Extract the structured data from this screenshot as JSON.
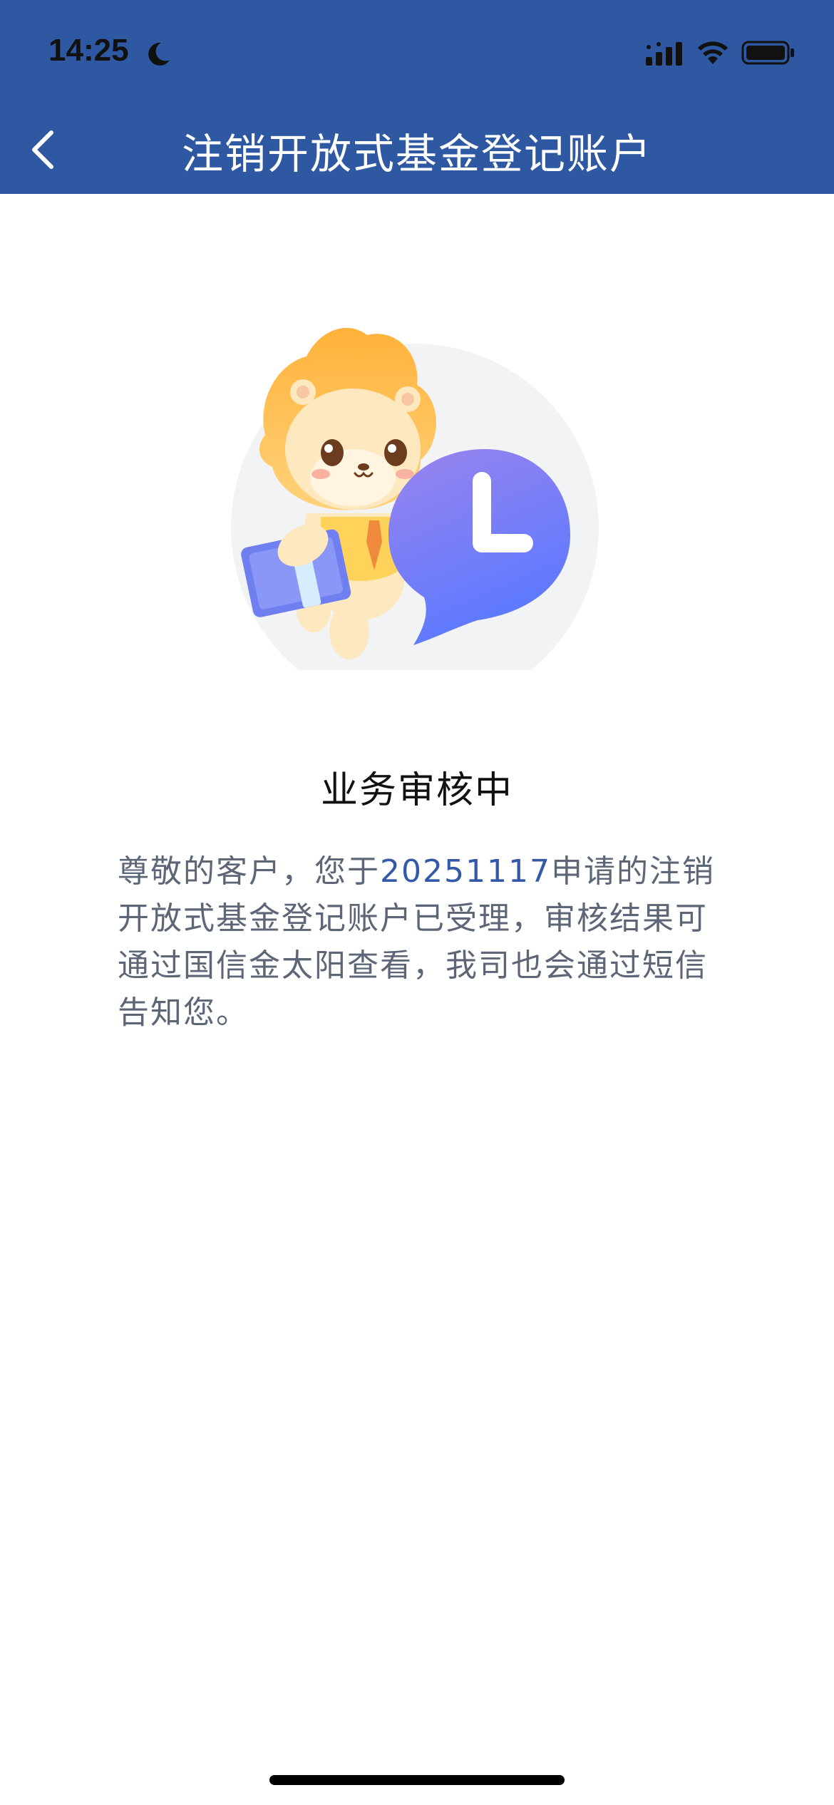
{
  "status_bar": {
    "time": "14:25",
    "moon_icon": "moon-icon",
    "signal_icon": "cellular-signal-icon",
    "wifi_icon": "wifi-icon",
    "battery_icon": "battery-icon"
  },
  "nav": {
    "back_icon": "chevron-left-icon",
    "title": "注销开放式基金登记账户"
  },
  "colors": {
    "header_bg": "#2f58a3",
    "text_primary": "#111111",
    "text_secondary": "#5c6677",
    "accent_date": "#3359a8",
    "clock_bubble": "#6b7af0"
  },
  "status": {
    "illustration": "lion-mascot-with-clock-bubble",
    "title": "业务审核中",
    "message_prefix": "尊敬的客户，您于",
    "message_date": "20251117",
    "message_suffix": "申请的注销开放式基金登记账户已受理，审核结果可通过国信金太阳查看，我司也会通过短信告知您。"
  }
}
